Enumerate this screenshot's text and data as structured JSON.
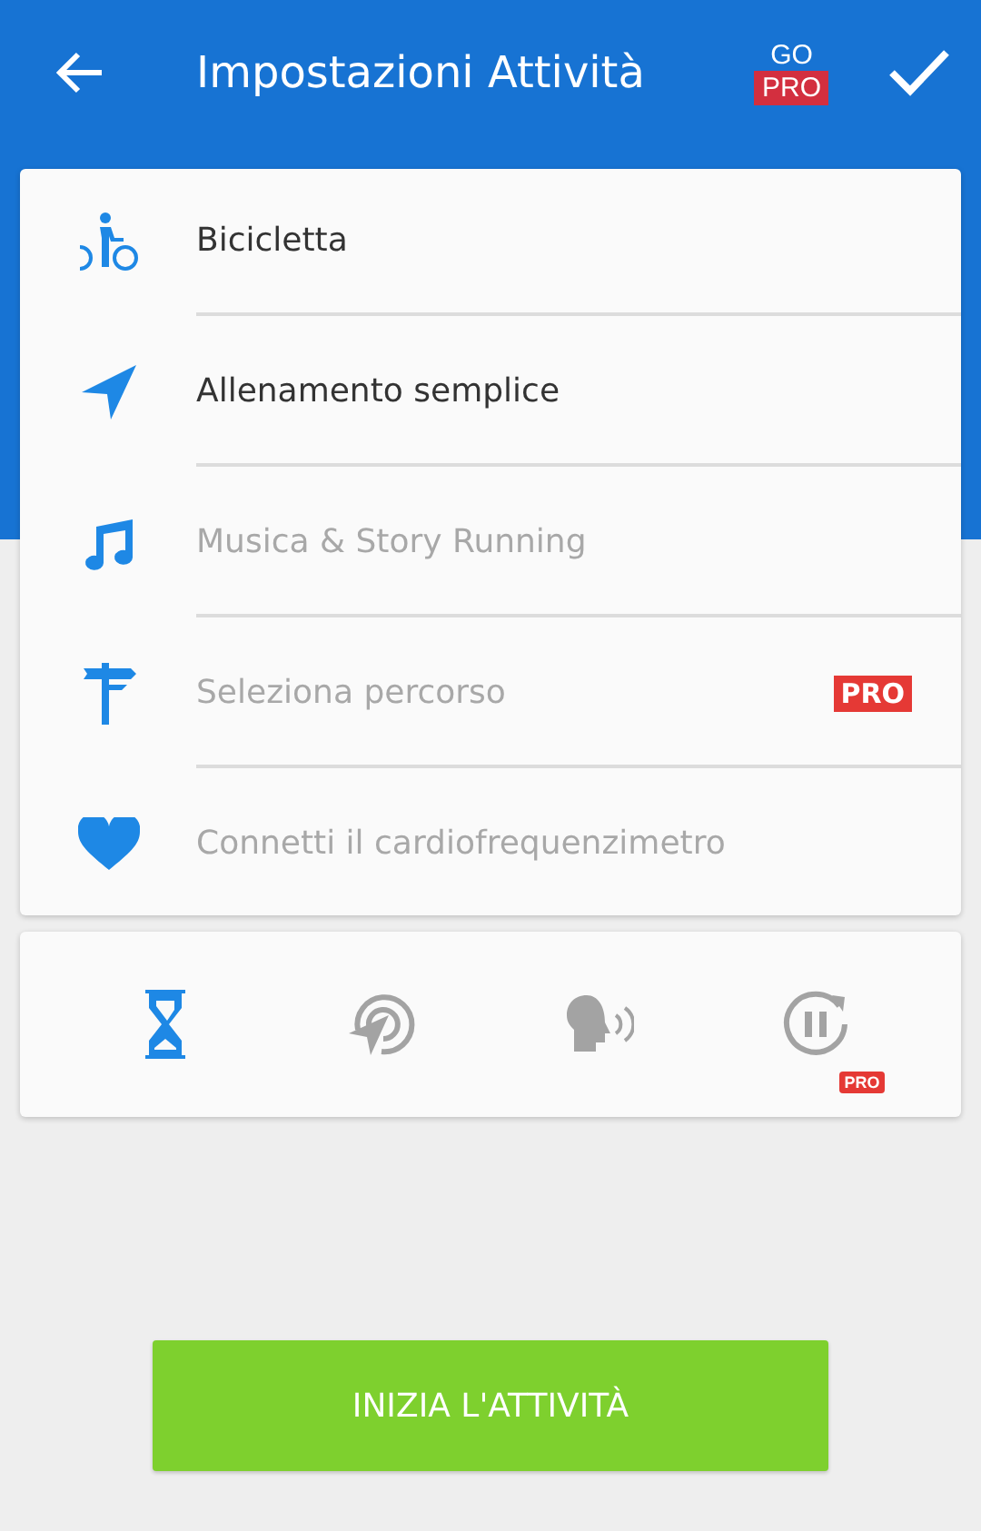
{
  "app_bar": {
    "title": "Impostazioni Attività",
    "go_label": "GO",
    "pro_label": "PRO"
  },
  "settings": [
    {
      "kind": "bike",
      "label": "Bicicletta",
      "enabled": true
    },
    {
      "kind": "navigation",
      "label": "Allenamento semplice",
      "enabled": true
    },
    {
      "kind": "music",
      "label": "Musica & Story Running",
      "enabled": false
    },
    {
      "kind": "signpost",
      "label": "Seleziona percorso",
      "enabled": false,
      "badge": "PRO"
    },
    {
      "kind": "heart",
      "label": "Connetti il cardiofrequenzimetro",
      "enabled": false
    }
  ],
  "tools": [
    {
      "kind": "timer",
      "active": true
    },
    {
      "kind": "target",
      "active": false
    },
    {
      "kind": "voice",
      "active": false
    },
    {
      "kind": "autopause",
      "active": false,
      "badge": "PRO"
    }
  ],
  "start_button": "INIZIA L'ATTIVITÀ"
}
